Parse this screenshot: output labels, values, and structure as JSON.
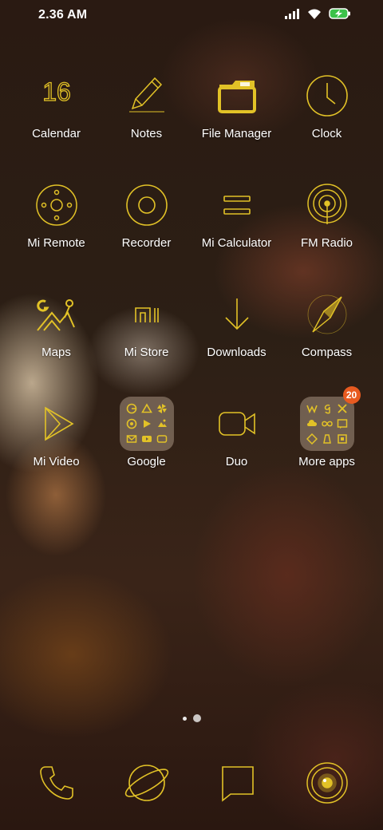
{
  "status_bar": {
    "time": "2.36 AM",
    "icons": [
      "signal-icon",
      "wifi-icon",
      "battery-charging-icon"
    ]
  },
  "theme": {
    "icon_color": "#e2c227",
    "badge_color": "#e85a20",
    "label_color": "#ffffff"
  },
  "calendar": {
    "day": "16"
  },
  "apps": [
    {
      "label": "Calendar",
      "icon": "calendar-icon"
    },
    {
      "label": "Notes",
      "icon": "pencil-icon"
    },
    {
      "label": "File Manager",
      "icon": "folder-icon"
    },
    {
      "label": "Clock",
      "icon": "clock-icon"
    },
    {
      "label": "Mi Remote",
      "icon": "remote-icon"
    },
    {
      "label": "Recorder",
      "icon": "recorder-icon"
    },
    {
      "label": "Mi Calculator",
      "icon": "equals-icon"
    },
    {
      "label": "FM Radio",
      "icon": "radio-icon"
    },
    {
      "label": "Maps",
      "icon": "map-icon"
    },
    {
      "label": "Mi Store",
      "icon": "mi-logo-icon"
    },
    {
      "label": "Downloads",
      "icon": "download-arrow-icon"
    },
    {
      "label": "Compass",
      "icon": "compass-icon"
    },
    {
      "label": "Mi Video",
      "icon": "play-icon"
    },
    {
      "label": "Google",
      "icon": "folder-google"
    },
    {
      "label": "Duo",
      "icon": "video-camera-icon"
    },
    {
      "label": "More apps",
      "icon": "folder-more-apps",
      "badge": "20"
    }
  ],
  "page_indicator": {
    "pages": 2,
    "current": 2
  },
  "dock": [
    {
      "icon": "phone-icon"
    },
    {
      "icon": "browser-planet-icon"
    },
    {
      "icon": "messages-icon"
    },
    {
      "icon": "camera-icon"
    }
  ]
}
